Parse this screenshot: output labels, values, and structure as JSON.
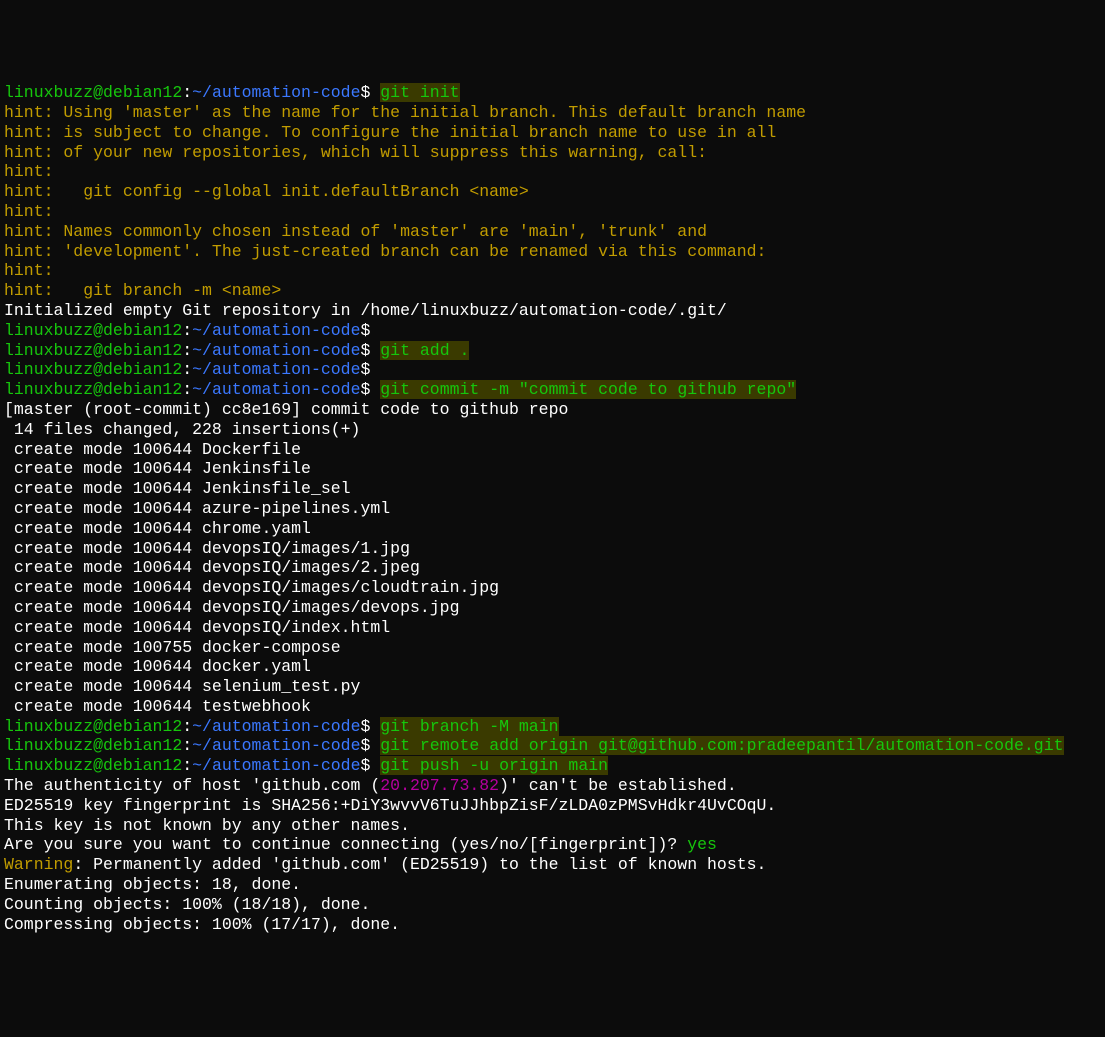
{
  "prompt": {
    "user": "linuxbuzz@debian12",
    "sep": ":",
    "path": "~/automation-code",
    "dollar": "$"
  },
  "commands": {
    "git_init": "git init",
    "git_add": "git add .",
    "git_commit": "git commit -m \"commit code to github repo\"",
    "git_branch": "git branch -M main",
    "git_remote": "git remote add origin git@github.com:pradeepantil/automation-code.git",
    "git_push": "git push -u origin main"
  },
  "hints": {
    "l1": "hint: Using 'master' as the name for the initial branch. This default branch name",
    "l2": "hint: is subject to change. To configure the initial branch name to use in all",
    "l3": "hint: of your new repositories, which will suppress this warning, call:",
    "l4": "hint:",
    "l5": "hint:   git config --global init.defaultBranch <name>",
    "l6": "hint:",
    "l7": "hint: Names commonly chosen instead of 'master' are 'main', 'trunk' and",
    "l8": "hint: 'development'. The just-created branch can be renamed via this command:",
    "l9": "hint:",
    "l10": "hint:   git branch -m <name>"
  },
  "init_msg": "Initialized empty Git repository in /home/linuxbuzz/automation-code/.git/",
  "commit": {
    "header": "[master (root-commit) cc8e169] commit code to github repo",
    "stats": " 14 files changed, 228 insertions(+)",
    "f1": " create mode 100644 Dockerfile",
    "f2": " create mode 100644 Jenkinsfile",
    "f3": " create mode 100644 Jenkinsfile_sel",
    "f4": " create mode 100644 azure-pipelines.yml",
    "f5": " create mode 100644 chrome.yaml",
    "f6": " create mode 100644 devopsIQ/images/1.jpg",
    "f7": " create mode 100644 devopsIQ/images/2.jpeg",
    "f8": " create mode 100644 devopsIQ/images/cloudtrain.jpg",
    "f9": " create mode 100644 devopsIQ/images/devops.jpg",
    "f10": " create mode 100644 devopsIQ/index.html",
    "f11": " create mode 100755 docker-compose",
    "f12": " create mode 100644 docker.yaml",
    "f13": " create mode 100644 selenium_test.py",
    "f14": " create mode 100644 testwebhook"
  },
  "ssh": {
    "auth_pre": "The authenticity of host 'github.com (",
    "ip": "20.207.73.82",
    "auth_post": ")' can't be established.",
    "fingerprint": "ED25519 key fingerprint is SHA256:+DiY3wvvV6TuJJhbpZisF/zLDA0zPMSvHdkr4UvCOqU.",
    "unknown": "This key is not known by any other names.",
    "question": "Are you sure you want to continue connecting (yes/no/[fingerprint])? ",
    "yes": "yes",
    "warning_label": "Warning",
    "warning_text": ": Permanently added 'github.com' (ED25519) to the list of known hosts."
  },
  "push": {
    "enum": "Enumerating objects: 18, done.",
    "count": "Counting objects: 100% (18/18), done.",
    "compress": "Compressing objects: 100% (17/17), done."
  }
}
